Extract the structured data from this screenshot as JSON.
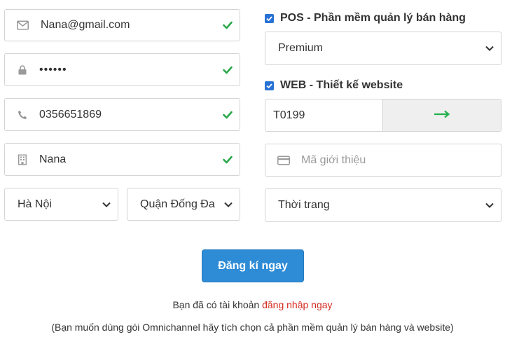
{
  "left_form": {
    "email": {
      "value": "Nana@gmail.com",
      "icon": "mail-icon"
    },
    "password": {
      "value": "••••••",
      "icon": "lock-icon"
    },
    "phone": {
      "value": "0356651869",
      "icon": "phone-icon"
    },
    "name": {
      "value": "Nana",
      "icon": "building-icon"
    },
    "city": {
      "value": "Hà Nội"
    },
    "district": {
      "value": "Quận Đống Đa"
    }
  },
  "right_form": {
    "pos": {
      "label": "POS - Phần mềm quản lý bán hàng",
      "checked": true,
      "plan": "Premium"
    },
    "web": {
      "label": "WEB - Thiết kế website",
      "checked": true,
      "template_code": "T0199"
    },
    "referral": {
      "placeholder": "Mã giới thiệu",
      "icon": "card-icon"
    },
    "industry": {
      "value": "Thời trang"
    }
  },
  "submit_label": "Đăng kí ngay",
  "login_prompt": {
    "text": "Bạn đã có tài khoản ",
    "link": "đăng nhập ngay"
  },
  "note": "(Bạn muốn dùng gói Omnichannel hãy tích chọn cả phần mềm quản lý bán hàng và website)",
  "colors": {
    "check": "#2aa84a",
    "accent": "#2e8bd6",
    "link": "#d42a1f",
    "arrow": "#22b14c"
  }
}
